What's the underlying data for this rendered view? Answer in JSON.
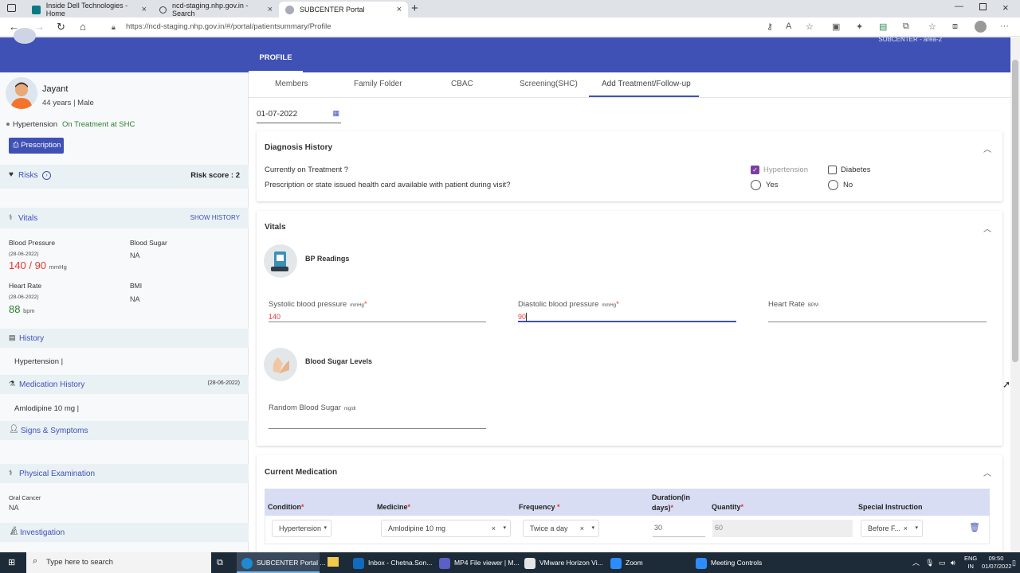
{
  "browser": {
    "tabs": [
      {
        "title": "Inside Dell Technologies - Home",
        "icon": "dell-icon"
      },
      {
        "title": "ncd-staging.nhp.gov.in - Search",
        "icon": "search-icon"
      },
      {
        "title": "SUBCENTER Portal",
        "icon": "portal-icon"
      }
    ],
    "url": "https://ncd-staging.nhp.gov.in/#/portal/patientsummary/Profile"
  },
  "header": {
    "profile_tab": "PROFILE",
    "subcenter_label": "SUBCENTER - area-2"
  },
  "patient": {
    "name": "Jayant",
    "age_gender": "44 years | Male",
    "condition": "Hypertension",
    "status": "On Treatment at SHC",
    "prescription_button": "Prescription"
  },
  "risks": {
    "label": "Risks",
    "score_label": "Risk score : 2"
  },
  "vitals_panel": {
    "title": "Vitals",
    "show_history": "SHOW HISTORY",
    "bp_label": "Blood Pressure",
    "bp_date": "(28-06-2022)",
    "bp_sys": "140",
    "bp_sep": "/",
    "bp_dia": "90",
    "bp_unit": "mmHg",
    "sugar_label": "Blood Sugar",
    "sugar_value": "NA",
    "hr_label": "Heart Rate",
    "hr_date": "(28-06-2022)",
    "hr_value": "88",
    "hr_unit": "bpm",
    "bmi_label": "BMI",
    "bmi_value": "NA"
  },
  "history": {
    "title": "History",
    "value": "Hypertension |"
  },
  "medication_history": {
    "title": "Medication History",
    "date": "(28-06-2022)",
    "value": "Amlodipine 10 mg |"
  },
  "signs": {
    "title": "Signs & Symptoms"
  },
  "physical": {
    "title": "Physical Examination",
    "oral_label": "Oral Cancer",
    "oral_value": "NA"
  },
  "investigation": {
    "title": "Investigation"
  },
  "subtabs": [
    "Members",
    "Family Folder",
    "CBAC",
    "Screening(SHC)",
    "Add Treatment/Follow-up"
  ],
  "date_value": "01-07-2022",
  "diagnosis": {
    "title": "Diagnosis History",
    "q1": "Currently on Treatment ?",
    "q2": "Prescription or state issued health card available with patient during visit?",
    "opt_hypertension": "Hypertension",
    "opt_diabetes": "Diabetes",
    "opt_yes": "Yes",
    "opt_no": "No"
  },
  "vitals": {
    "title": "Vitals",
    "bp_title": "BP Readings",
    "sys_label": "Systolic blood pressure",
    "sys_unit": "mmHg",
    "sys_value": "140",
    "dia_label": "Diastolic blood pressure",
    "dia_unit": "mmHg",
    "dia_value": "90",
    "hr_label": "Heart Rate",
    "hr_unit": "BPM",
    "sugar_title": "Blood Sugar Levels",
    "rbs_label": "Random Blood Sugar",
    "rbs_unit": "mg/dl"
  },
  "medication": {
    "title": "Current Medication",
    "headers": {
      "condition": "Condition",
      "medicine": "Medicine",
      "frequency": "Frequency",
      "duration1": "Duration(in",
      "duration2": "days)",
      "quantity": "Quantity",
      "special": "Special Instruction"
    },
    "row": {
      "condition": "Hypertension",
      "medicine": "Amlodipine 10 mg",
      "frequency": "Twice a day",
      "duration": "30",
      "quantity": "60",
      "special": "Before F..."
    }
  },
  "taskbar": {
    "search_placeholder": "Type here to search",
    "apps": [
      "SUBCENTER Portal ...",
      "Inbox - Chetna.Son...",
      "MP4 File viewer | M...",
      "VMware Horizon Vi...",
      "Zoom",
      "Meeting Controls"
    ],
    "lang1": "ENG",
    "lang2": "IN",
    "time": "09:50",
    "date": "01/07/2022"
  },
  "colors": {
    "primary": "#3f51b5",
    "danger": "#e53935",
    "success": "#2e7d32",
    "purple": "#7b3fa0"
  }
}
